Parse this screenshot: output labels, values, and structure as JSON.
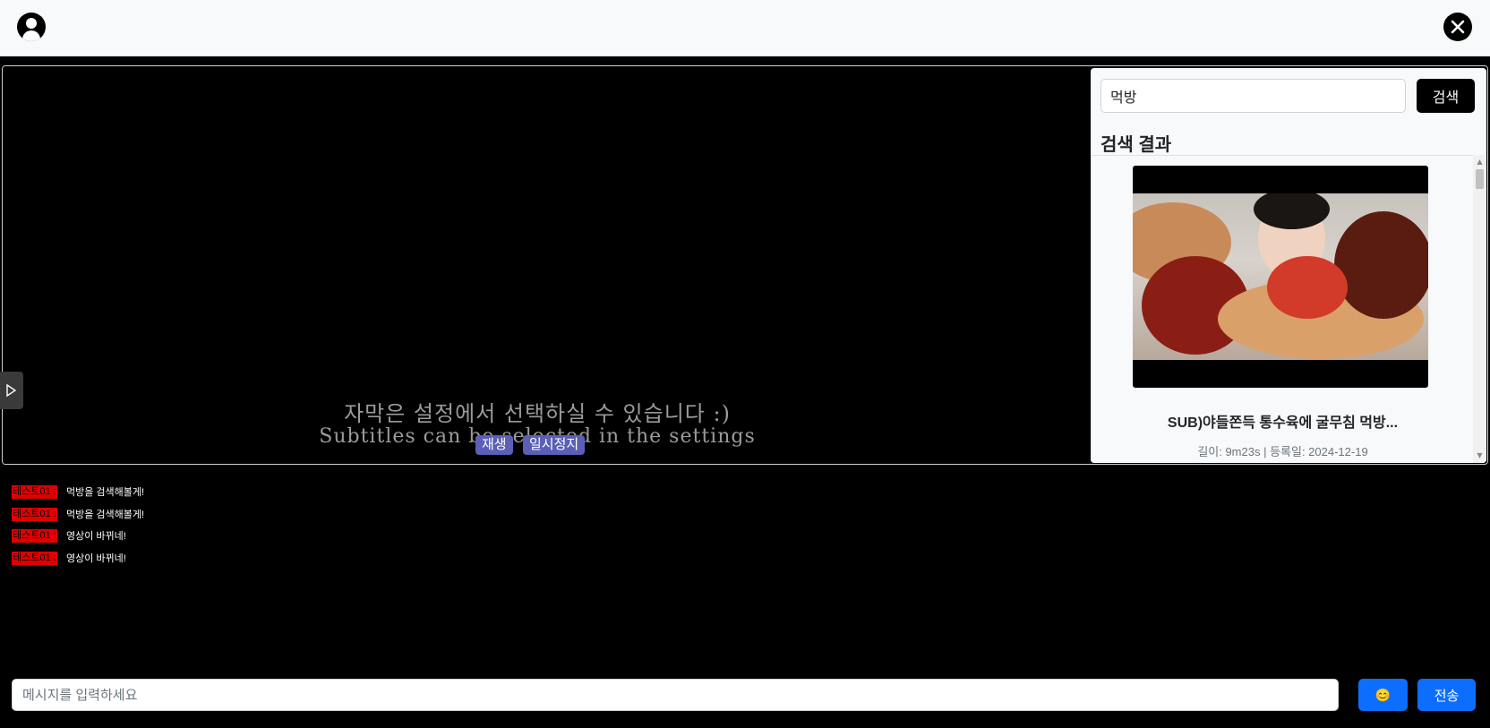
{
  "header": {
    "avatar_icon": "user-circle-icon",
    "close_icon": "close-icon"
  },
  "video": {
    "subtitle_ko": "자막은 설정에서 선택하실 수 있습니다 :)",
    "subtitle_en": "Subtitles can be selected in the settings",
    "play_label": "재생",
    "pause_label": "일시정지",
    "toggle_icon": "play-triangle-icon"
  },
  "search": {
    "query": "먹방",
    "button_label": "검색",
    "results_title": "검색 결과",
    "results": [
      {
        "title": "SUB)야들쫀득 통수육에 굴무침 먹방...",
        "meta": "길이: 9m23s | 등록일: 2024-12-19"
      }
    ]
  },
  "chat": {
    "messages": [
      {
        "user": "테스트01 :",
        "text": "먹방을 검색해볼게!"
      },
      {
        "user": "테스트01 :",
        "text": "먹방을 검색해볼게!"
      },
      {
        "user": "테스트01 :",
        "text": "영상이 바뀌네!"
      },
      {
        "user": "테스트01 :",
        "text": "영상이 바뀌네!"
      }
    ],
    "input_placeholder": "메시지를 입력하세요",
    "emoji_label": "😊",
    "send_label": "전송"
  },
  "colors": {
    "accent": "#0d6efd",
    "video_control": "#5b5fb5",
    "chat_user_bg": "#e00000"
  }
}
